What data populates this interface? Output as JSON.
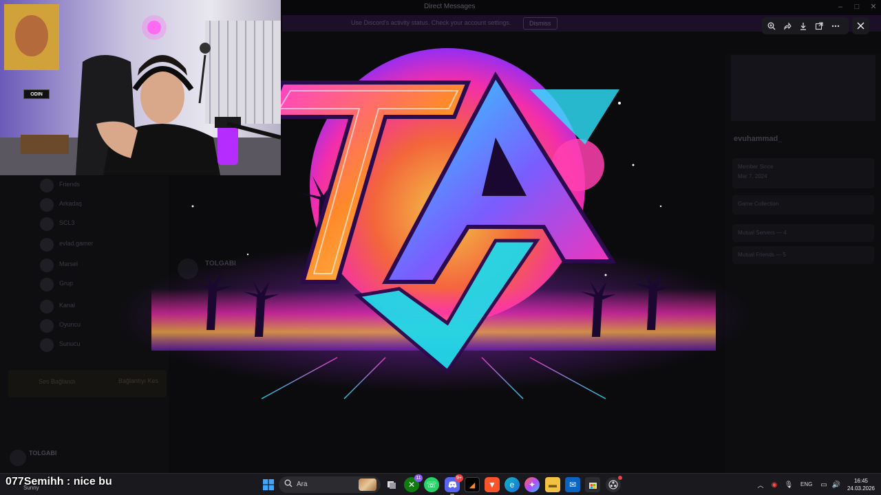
{
  "window": {
    "title": "Direct Messages"
  },
  "banner": {
    "text": "Use Discord's activity status. Check your account settings.",
    "button": "Dismiss"
  },
  "sidebar": {
    "dms": [
      "Friends",
      "Arkadaş",
      "SCL3",
      "evlad.gamer",
      "Marsel",
      "Grup",
      "Kanal",
      "Oyuncu",
      "Sunucu"
    ],
    "voice": {
      "status": "Ses Bağlandı",
      "button": "Bağlantıyı Kes"
    },
    "user": {
      "name": "TOLGABI"
    }
  },
  "channel": {
    "name": "TOLGABI"
  },
  "profile": {
    "username": "evuhammad_",
    "member_since_label": "Member Since",
    "member_since_value": "Mar 7, 2024",
    "connections_label": "Game Collection",
    "mutual_servers": "Mutual Servers — 4",
    "mutual_friends": "Mutual Friends — 5"
  },
  "viewer": {
    "zoom_icon": "zoom-in-icon",
    "forward_icon": "forward-icon",
    "download_icon": "download-icon",
    "open_external_icon": "open-external-icon",
    "more_icon": "more-icon",
    "close_icon": "close-icon"
  },
  "webcam": {
    "sign_text": "ODIN"
  },
  "taskbar": {
    "search_placeholder": "Ara",
    "weather_label": "Sunny",
    "language": "ENG",
    "time": "16:45",
    "date": "24.03.2026",
    "badges": {
      "xbox": "11",
      "discord": "9+"
    }
  },
  "chat": {
    "username": "077Semihh",
    "separator": " : ",
    "message": "nice bu"
  },
  "colors": {
    "accent_pink": "#ff2fb4",
    "accent_cyan": "#22e6ff",
    "accent_purple": "#9b30ff",
    "accent_orange": "#ff8a2a"
  }
}
